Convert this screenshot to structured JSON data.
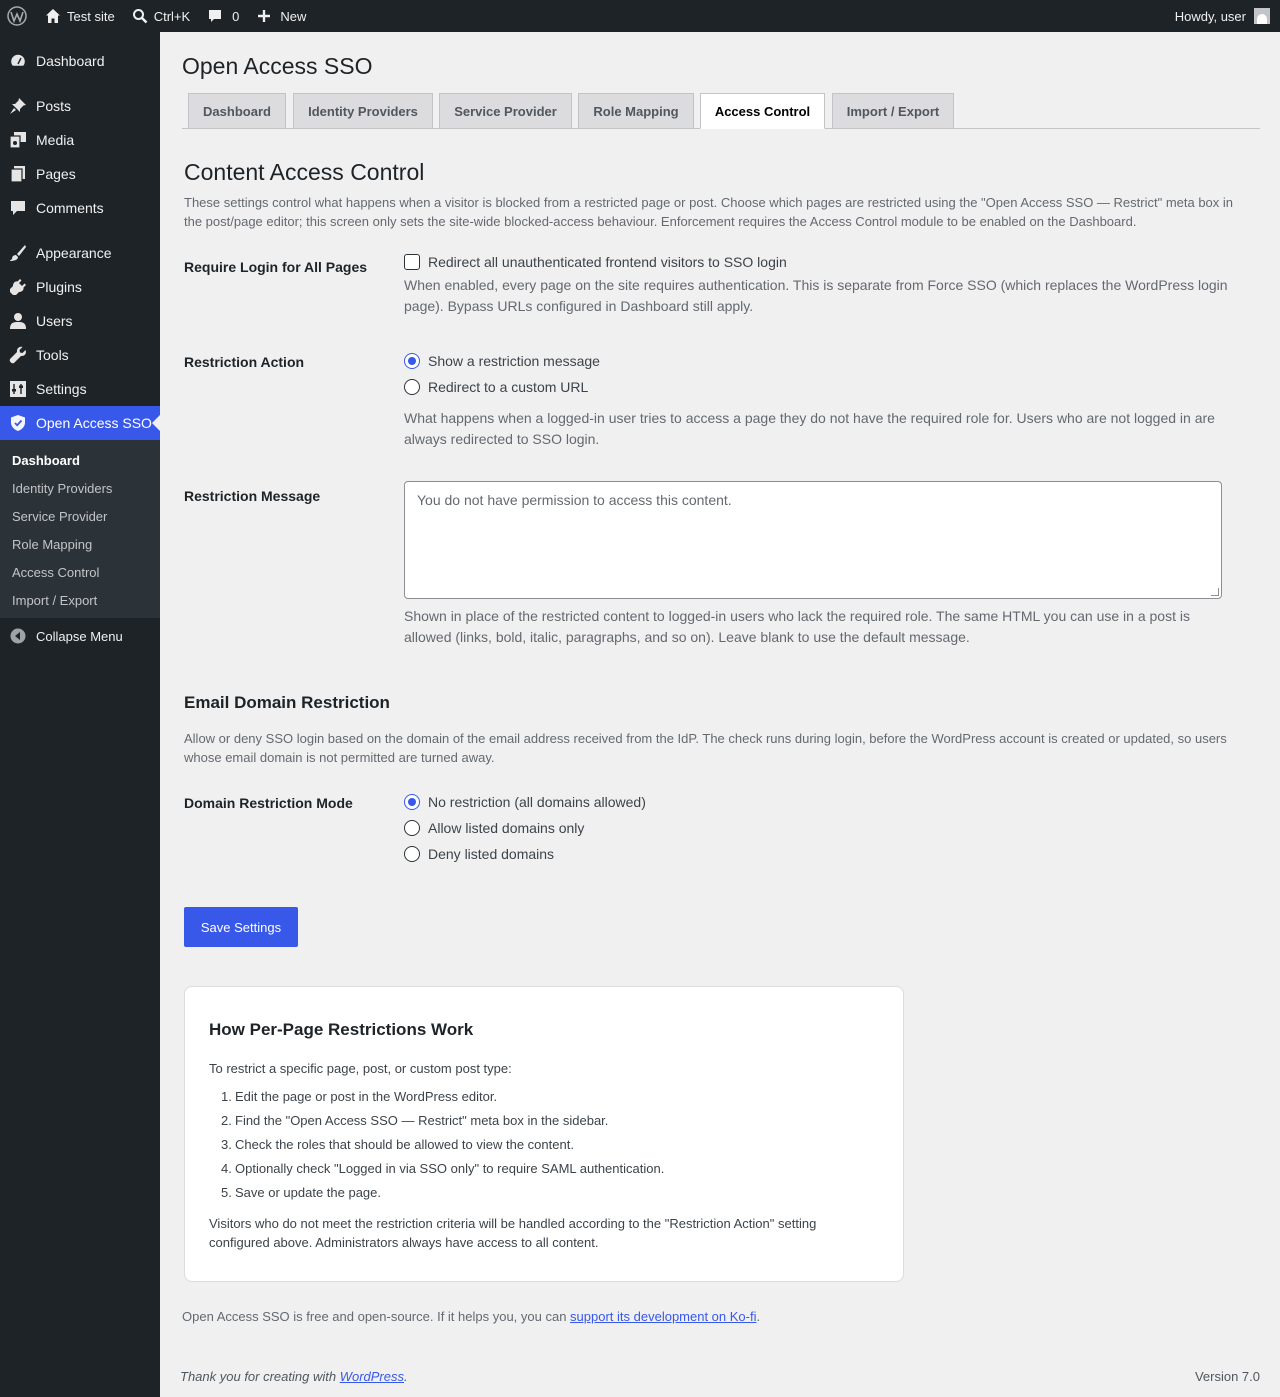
{
  "adminbar": {
    "site_name": "Test site",
    "search_shortcut": "Ctrl+K",
    "comments_count": "0",
    "new_label": "New",
    "howdy": "Howdy, user"
  },
  "sidebar": {
    "items": [
      {
        "label": "Dashboard",
        "icon": "dashboard-icon"
      },
      {
        "label": "Posts",
        "icon": "pin-icon"
      },
      {
        "label": "Media",
        "icon": "media-icon"
      },
      {
        "label": "Pages",
        "icon": "pages-icon"
      },
      {
        "label": "Comments",
        "icon": "comment-icon"
      },
      {
        "label": "Appearance",
        "icon": "brush-icon"
      },
      {
        "label": "Plugins",
        "icon": "plug-icon"
      },
      {
        "label": "Users",
        "icon": "user-icon"
      },
      {
        "label": "Tools",
        "icon": "wrench-icon"
      },
      {
        "label": "Settings",
        "icon": "settings-icon"
      },
      {
        "label": "Open Access SSO",
        "icon": "shield-icon"
      }
    ],
    "submenu": [
      "Dashboard",
      "Identity Providers",
      "Service Provider",
      "Role Mapping",
      "Access Control",
      "Import / Export"
    ],
    "collapse": "Collapse Menu"
  },
  "page": {
    "title": "Open Access SSO",
    "tabs": [
      "Dashboard",
      "Identity Providers",
      "Service Provider",
      "Role Mapping",
      "Access Control",
      "Import / Export"
    ],
    "active_tab": "Access Control"
  },
  "content_access": {
    "heading": "Content Access Control",
    "description_line1": "These settings control what happens when a visitor is blocked from a restricted page or post. Choose which pages are restricted using the \"Open Access SSO — Restrict\" meta box in",
    "description_line2": "the post/page editor; this screen only sets the site-wide blocked-access behaviour. Enforcement requires the Access Control module to be enabled on the Dashboard.",
    "require_login": {
      "label": "Require Login for All Pages",
      "checkbox_label": "Redirect all unauthenticated frontend visitors to SSO login",
      "checked": false,
      "help_line1": "When enabled, every page on the site requires authentication. This is separate from Force SSO (which replaces the WordPress login",
      "help_line2": "page). Bypass URLs configured in Dashboard still apply."
    },
    "restriction_action": {
      "label": "Restriction Action",
      "options": [
        "Show a restriction message",
        "Redirect to a custom URL"
      ],
      "selected": "Show a restriction message",
      "help_line1": "What happens when a logged-in user tries to access a page they do not have the required role for. Users who are not logged in are",
      "help_line2": "always redirected to SSO login."
    },
    "restriction_message": {
      "label": "Restriction Message",
      "placeholder": "You do not have permission to access this content.",
      "value": "",
      "help_line1": "Shown in place of the restricted content to logged-in users who lack the required role. The same HTML you can use in a post is",
      "help_line2": "allowed (links, bold, italic, paragraphs, and so on). Leave blank to use the default message."
    }
  },
  "email_domain": {
    "heading": "Email Domain Restriction",
    "description_line1": "Allow or deny SSO login based on the domain of the email address received from the IdP. The check runs during login, before the WordPress account is created or updated, so users",
    "description_line2": "whose email domain is not permitted are turned away.",
    "mode": {
      "label": "Domain Restriction Mode",
      "options": [
        "No restriction (all domains allowed)",
        "Allow listed domains only",
        "Deny listed domains"
      ],
      "selected": "No restriction (all domains allowed)"
    }
  },
  "save_button": "Save Settings",
  "info_card": {
    "title": "How Per-Page Restrictions Work",
    "intro": "To restrict a specific page, post, or custom post type:",
    "steps": [
      "Edit the page or post in the WordPress editor.",
      "Find the \"Open Access SSO — Restrict\" meta box in the sidebar.",
      "Check the roles that should be allowed to view the content.",
      "Optionally check \"Logged in via SSO only\" to require SAML authentication.",
      "Save or update the page."
    ],
    "outro_line1": "Visitors who do not meet the restriction criteria will be handled according to the \"Restriction Action\" setting",
    "outro_line2": "configured above. Administrators always have access to all content."
  },
  "footer": {
    "note_prefix": "Open Access SSO is free and open-source. If it helps you, you can ",
    "note_link": "support its development on Ko-fi",
    "note_suffix": ".",
    "thanks_prefix": "Thank you for creating with ",
    "thanks_link": "WordPress",
    "thanks_suffix": ".",
    "version": "Version 7.0"
  },
  "colors": {
    "accent": "#3858e9",
    "adminbar_bg": "#1d2327",
    "page_bg": "#f0f0f1"
  }
}
